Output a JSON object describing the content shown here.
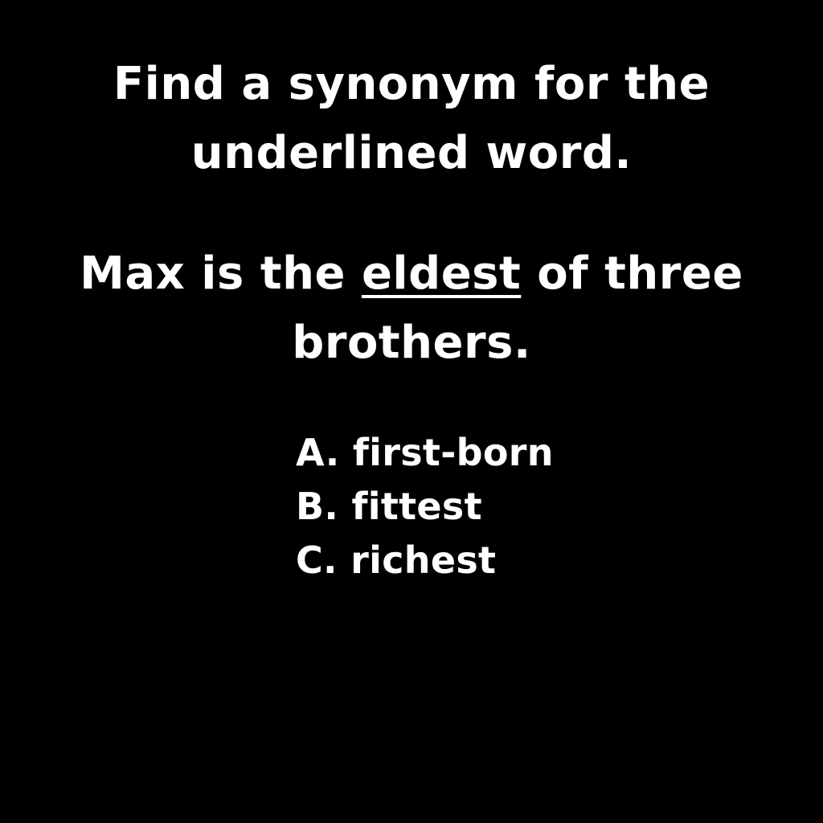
{
  "background_color": "#000000",
  "text_color": "#ffffff",
  "instruction": "Find a synonym for the underlined word.",
  "sentence": {
    "before": "Max is the ",
    "target": "eldest",
    "after": " of three brothers."
  },
  "options": [
    {
      "letter": "A.",
      "text": "first-born"
    },
    {
      "letter": "B.",
      "text": "fittest"
    },
    {
      "letter": "C.",
      "text": "richest"
    }
  ]
}
